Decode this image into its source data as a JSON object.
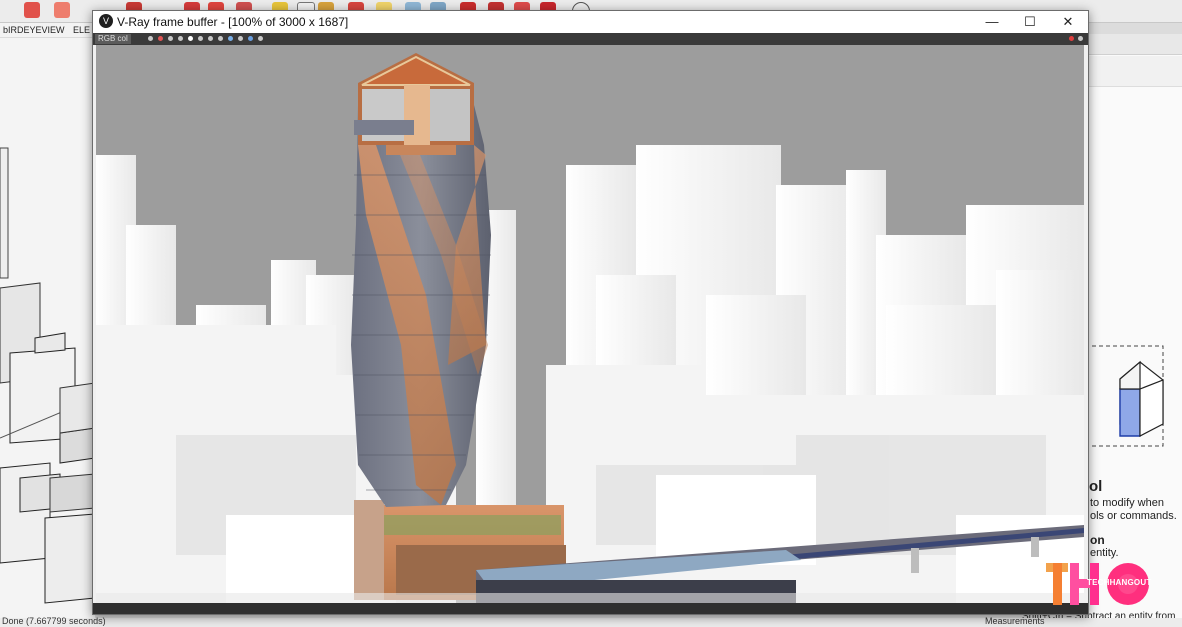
{
  "vfb": {
    "title": "V-Ray frame buffer - [100% of 3000 x 1687]",
    "channel": "RGB col",
    "win_controls": {
      "minimize": "—",
      "maximize": "☐",
      "close": "✕"
    },
    "logo_glyph": "V"
  },
  "sketchup": {
    "scene_tabs": [
      "bIRDEYEVIEW",
      "ELE"
    ],
    "status_text": "Done (7.667799 seconds)",
    "measurements_label": "Measurements",
    "instructor": {
      "heading_partial": "ol",
      "line1": "to modify when",
      "line2": "ols or commands.",
      "heading2_partial": "on",
      "line3": "entity.",
      "line4": "Shift+Ctrl = Subtract an entity from"
    }
  },
  "watermark": {
    "text": "TECHHANGOUT"
  },
  "colors": {
    "sky": "#9d9d9d",
    "tower_copper": "#c98a5a",
    "tower_glass": "#6f7380",
    "window_chrome": "#ffffff"
  }
}
